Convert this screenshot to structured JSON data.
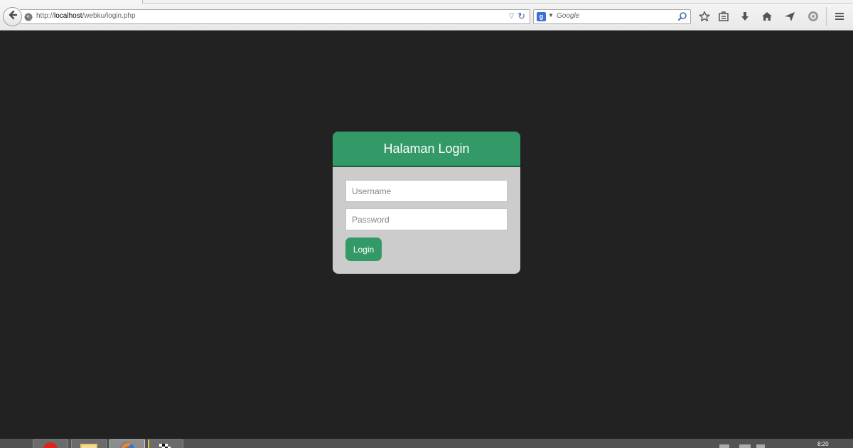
{
  "browser": {
    "url_prefix": "http://",
    "url_host": "localhost",
    "url_path": "/webku/login.php",
    "search_placeholder": "Google",
    "search_engine_icon": "google-icon",
    "toolbar_icons": [
      "bookmark-star-icon",
      "reading-list-icon",
      "download-icon",
      "home-icon",
      "share-icon",
      "pocket-icon",
      "menu-icon"
    ]
  },
  "login": {
    "title": "Halaman Login",
    "username_placeholder": "Username",
    "password_placeholder": "Password",
    "username_value": "",
    "password_value": "",
    "submit_label": "Login"
  },
  "taskbar": {
    "clock": "8:20",
    "apps": [
      "start-icon",
      "opera-icon",
      "file-explorer-icon",
      "firefox-icon",
      "racing-flag-icon"
    ]
  },
  "colors": {
    "accent": "#339966",
    "accent_dark": "#1e5c40",
    "card_bg": "#cccccc",
    "page_bg": "#222222"
  }
}
